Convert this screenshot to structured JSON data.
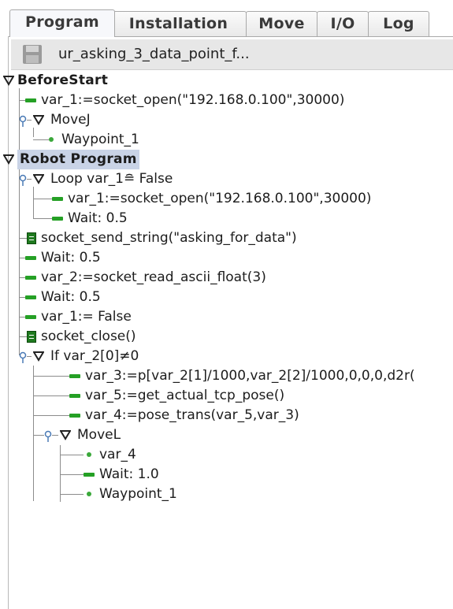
{
  "tabs": [
    {
      "label": "Program",
      "active": true
    },
    {
      "label": "Installation",
      "active": false
    },
    {
      "label": "Move",
      "active": false
    },
    {
      "label": "I/O",
      "active": false
    },
    {
      "label": "Log",
      "active": false
    }
  ],
  "file": {
    "name": "ur_asking_3_data_point_f...",
    "icon": "save-disk-icon"
  },
  "tree": {
    "before_start": "BeforeStart",
    "bs_socket_open": "var_1:=socket_open(\"192.168.0.100\",30000)",
    "movej": "MoveJ",
    "movej_waypoint": "Waypoint_1",
    "robot_program": "Robot Program",
    "loop": "Loop var_1≘ False",
    "loop_socket_open": "var_1:=socket_open(\"192.168.0.100\",30000)",
    "loop_wait": "Wait: 0.5",
    "send_string": "socket_send_string(\"asking_for_data\")",
    "wait_1": "Wait: 0.5",
    "read_ascii": "var_2:=socket_read_ascii_float(3)",
    "wait_2": "Wait: 0.5",
    "var1_false": "var_1:= False",
    "socket_close": "socket_close()",
    "if_stmt": "If var_2[0]≠0",
    "var_3": "var_3:=p[var_2[1]/1000,var_2[2]/1000,0,0,0,d2r(",
    "var_5": "var_5:=get_actual_tcp_pose()",
    "var_4": "var_4:=pose_trans(var_5,var_3)",
    "movel": "MoveL",
    "movel_var4": "var_4",
    "movel_wait": "Wait: 1.0",
    "movel_waypoint": "Waypoint_1"
  },
  "colors": {
    "command_green": "#25a025",
    "selection": "#c9d3e6"
  }
}
